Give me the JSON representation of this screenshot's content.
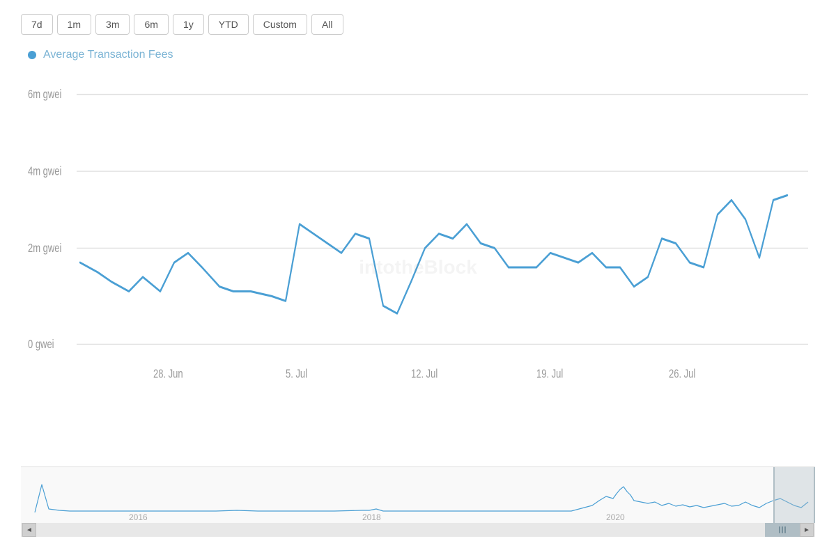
{
  "timeRange": {
    "buttons": [
      {
        "label": "7d",
        "id": "7d"
      },
      {
        "label": "1m",
        "id": "1m"
      },
      {
        "label": "3m",
        "id": "3m"
      },
      {
        "label": "6m",
        "id": "6m"
      },
      {
        "label": "1y",
        "id": "1y"
      },
      {
        "label": "YTD",
        "id": "ytd"
      },
      {
        "label": "Custom",
        "id": "custom"
      },
      {
        "label": "All",
        "id": "all"
      }
    ]
  },
  "legend": {
    "label": "Average Transaction Fees"
  },
  "yAxis": {
    "labels": [
      "6m gwei",
      "4m gwei",
      "2m gwei",
      "0 gwei"
    ]
  },
  "xAxis": {
    "labels": [
      "28. Jun",
      "5. Jul",
      "12. Jul",
      "19. Jul",
      "26. Jul"
    ]
  },
  "watermark": "intotheBlock",
  "navigator": {
    "xLabels": [
      "2016",
      "2018",
      "2020"
    ]
  },
  "scrollbar": {
    "leftArrow": "◄",
    "rightArrow": "►"
  }
}
